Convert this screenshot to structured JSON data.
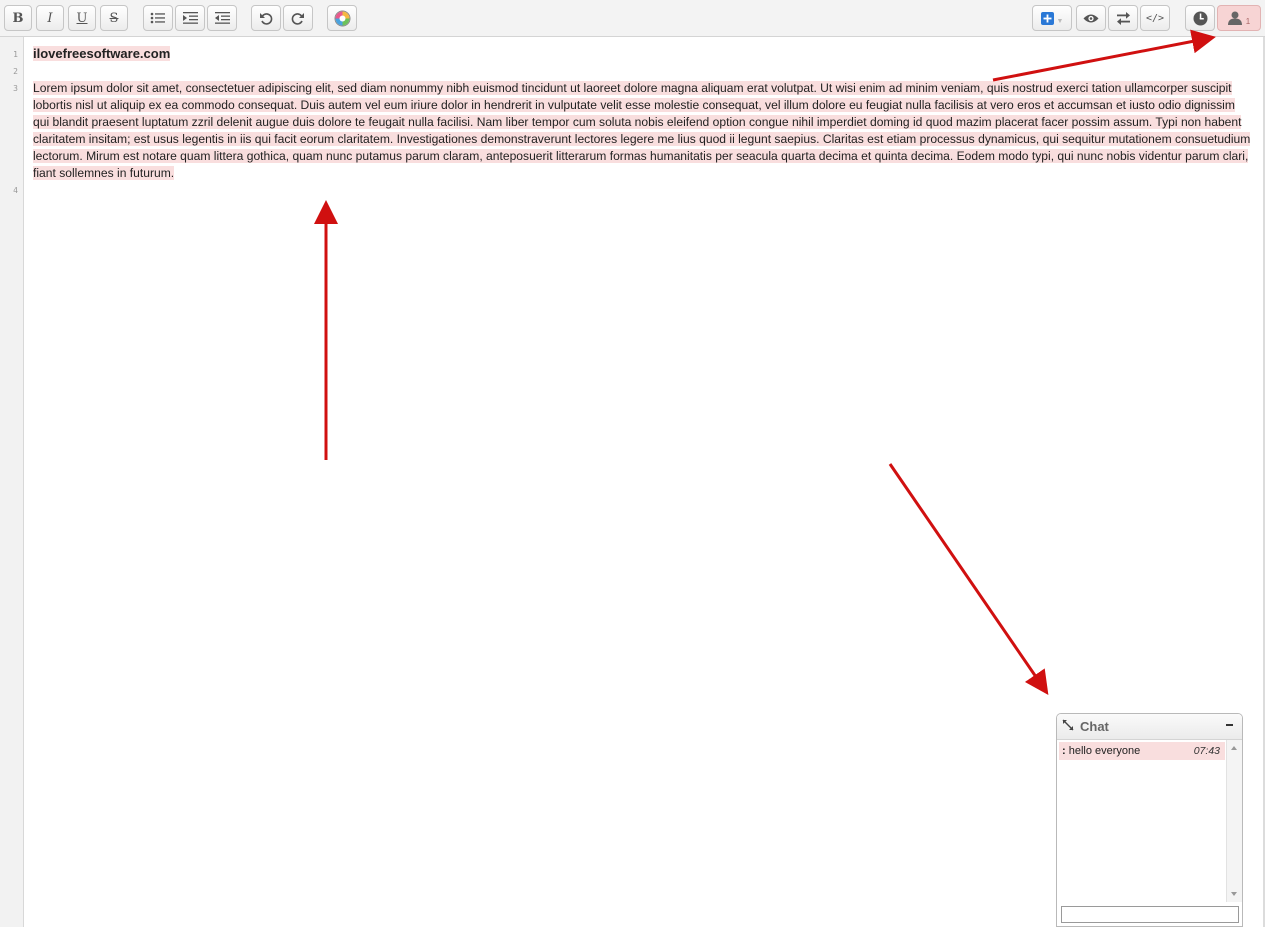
{
  "toolbar": {
    "left_buttons": [
      "bold",
      "italic",
      "underline",
      "strikethrough",
      "bulleted-list",
      "indent",
      "outdent",
      "undo",
      "redo",
      "author-colors"
    ],
    "right_buttons": [
      "insert-embed",
      "view",
      "import-export",
      "embed-code",
      "timeslider",
      "users"
    ],
    "bold_glyph": "B",
    "italic_glyph": "I",
    "underline_glyph": "U",
    "strike_glyph": "S",
    "users_count": "1"
  },
  "editor": {
    "line_numbers": [
      "1",
      "2",
      "3",
      "4"
    ],
    "title": "ilovefreesoftware.com",
    "paragraph": "Lorem ipsum dolor sit amet, consectetuer adipiscing elit, sed diam  nonummy nibh euismod tincidunt ut laoreet dolore magna aliquam erat  volutpat. Ut wisi enim ad minim veniam, quis nostrud exerci tation ullamcorper suscipit lobortis nisl ut aliquip ex ea commodo consequat.  Duis autem vel eum iriure dolor in hendrerit in vulputate velit esse  molestie consequat, vel illum dolore eu feugiat nulla facilisis at vero  eros et accumsan et iusto odio dignissim qui blandit praesent luptatum  zzril delenit augue duis dolore te feugait nulla facilisi. Nam liber  tempor cum soluta nobis eleifend option congue nihil imperdiet doming id  quod mazim placerat facer possim assum. Typi non habent claritatem  insitam; est usus legentis in iis qui facit eorum claritatem.  Investigationes demonstraverunt lectores legere me lius quod ii legunt  saepius. Claritas est etiam processus dynamicus, qui sequitur mutationem  consuetudium lectorum. Mirum est notare quam littera gothica, quam nunc  putamus parum claram, anteposuerit litterarum formas humanitatis per  seacula quarta decima et quinta decima. Eodem modo typi, qui nunc nobis  videntur parum clari, fiant sollemnes in futurum.",
    "author_highlight_color": "#f9dede"
  },
  "chat": {
    "title": "Chat",
    "messages": [
      {
        "sender": ":",
        "text": "hello everyone",
        "time": "07:43"
      }
    ],
    "input_value": ""
  },
  "annotations": {
    "arrow_color": "#d01010"
  }
}
